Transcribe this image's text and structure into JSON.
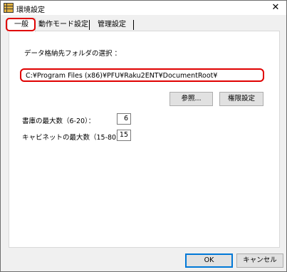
{
  "window": {
    "title": "環境設定",
    "close_glyph": "✕"
  },
  "tabs": [
    {
      "label": "一般",
      "active": true
    },
    {
      "label": "動作モード設定",
      "active": false
    },
    {
      "label": "管理設定",
      "active": false
    }
  ],
  "general": {
    "folder_label": "データ格納先フォルダの選択 ：",
    "folder_path": "C:¥Program Files (x86)¥PFU¥Raku2ENT¥DocumentRoot¥",
    "browse_button": "参照...",
    "permission_button": "権限設定",
    "max_bookshelf_label": "書庫の最大数（6-20）：",
    "max_bookshelf_value": "6",
    "max_cabinet_label": "キャビネットの最大数（15-80）：",
    "max_cabinet_value": "15"
  },
  "footer": {
    "ok_button": "OK",
    "cancel_button": "キャンセル"
  },
  "colors": {
    "highlight": "#e00000",
    "accent": "#0078d7"
  }
}
